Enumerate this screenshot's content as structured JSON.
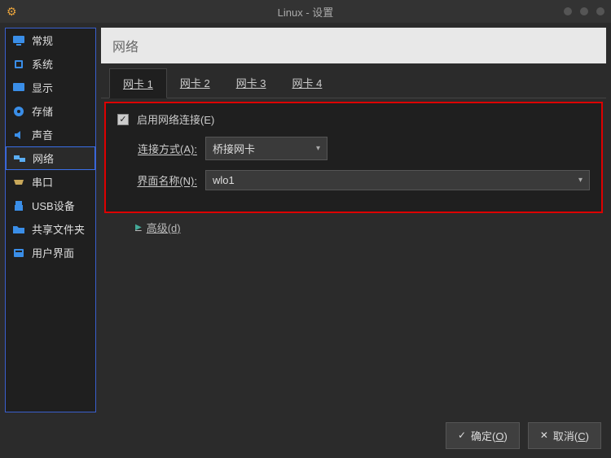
{
  "window": {
    "title": "Linux - 设置"
  },
  "sidebar": {
    "items": [
      {
        "label": "常规"
      },
      {
        "label": "系统"
      },
      {
        "label": "显示"
      },
      {
        "label": "存储"
      },
      {
        "label": "声音"
      },
      {
        "label": "网络"
      },
      {
        "label": "串口"
      },
      {
        "label": "USB设备"
      },
      {
        "label": "共享文件夹"
      },
      {
        "label": "用户界面"
      }
    ]
  },
  "main": {
    "header": "网络",
    "tabs": [
      {
        "label": "网卡 1"
      },
      {
        "label": "网卡 2"
      },
      {
        "label": "网卡 3"
      },
      {
        "label": "网卡 4"
      }
    ],
    "enable_label": "启用网络连接(E)",
    "attach_label": "连接方式(A):",
    "attach_value": "桥接网卡",
    "iface_label": "界面名称(N):",
    "iface_value": "wlo1",
    "advanced_label": "高级(d)"
  },
  "footer": {
    "ok": "确定(O)",
    "cancel": "取消(C)"
  }
}
